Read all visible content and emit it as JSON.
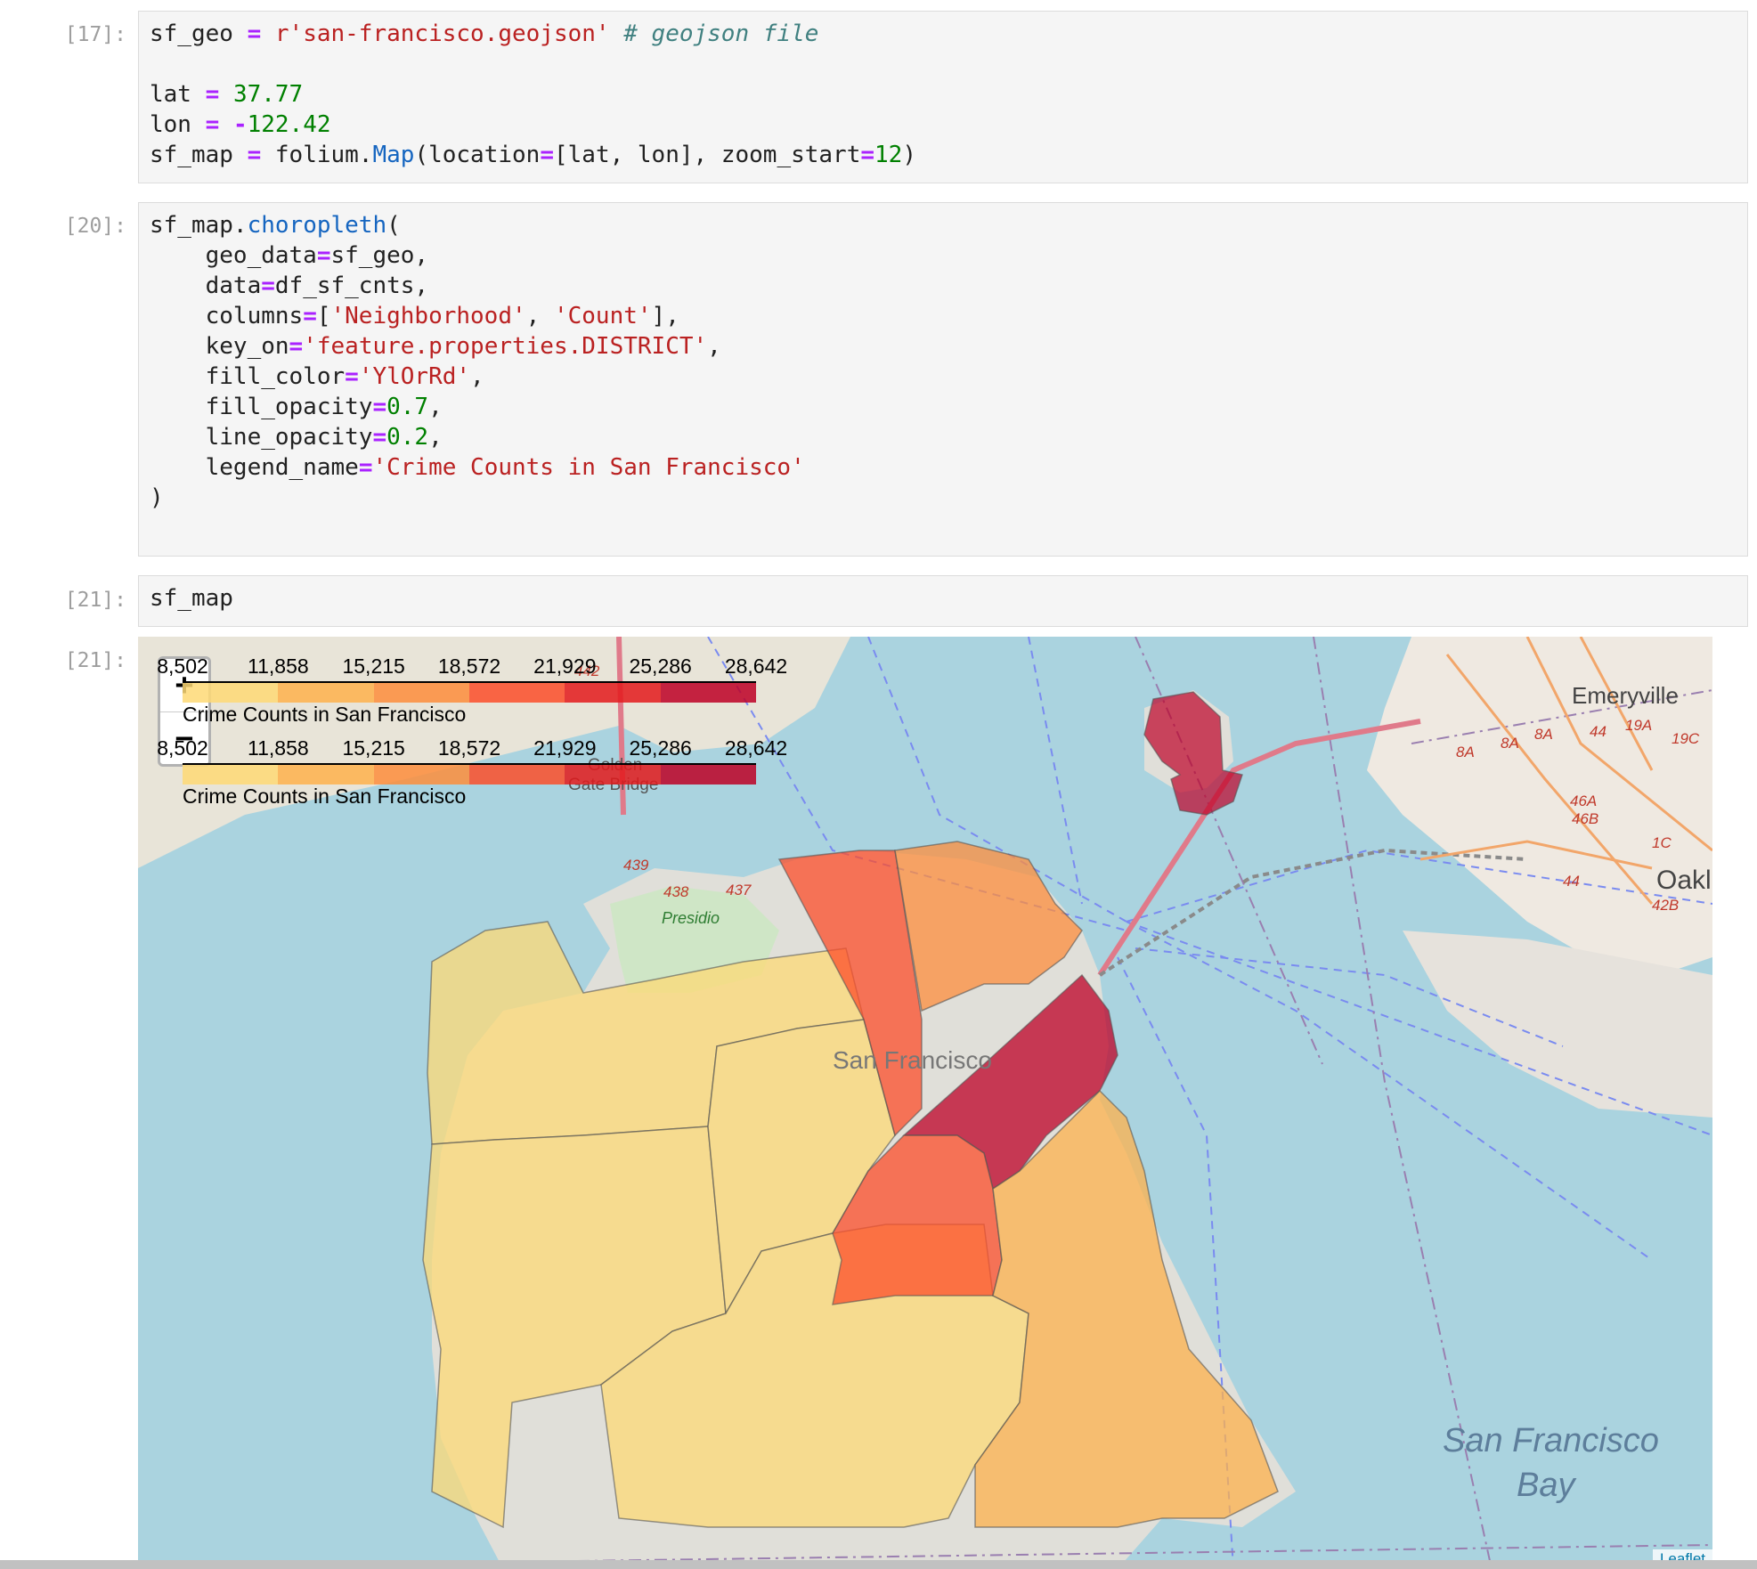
{
  "cells": [
    {
      "prompt": "[17]:",
      "lines": [
        [
          [
            "sf_geo ",
            ""
          ],
          [
            "=",
            "o"
          ],
          [
            " ",
            ""
          ],
          [
            "r'san-francisco.geojson'",
            "s"
          ],
          [
            " ",
            ""
          ],
          [
            "# geojson file",
            "c"
          ]
        ],
        [],
        [
          [
            "lat ",
            ""
          ],
          [
            "=",
            "o"
          ],
          [
            " ",
            ""
          ],
          [
            "37.77",
            "n"
          ]
        ],
        [
          [
            "lon ",
            ""
          ],
          [
            "=",
            "o"
          ],
          [
            " ",
            ""
          ],
          [
            "-",
            "o"
          ],
          [
            "122.42",
            "n"
          ]
        ],
        [
          [
            "sf_map ",
            ""
          ],
          [
            "=",
            "o"
          ],
          [
            " folium.",
            ""
          ],
          [
            "Map",
            "f"
          ],
          [
            "(location",
            ""
          ],
          [
            "=",
            "o"
          ],
          [
            "[lat, lon], zoom_start",
            ""
          ],
          [
            "=",
            "o"
          ],
          [
            "12",
            "n"
          ],
          [
            ")",
            ""
          ]
        ]
      ]
    },
    {
      "prompt": "[20]:",
      "lines": [
        [
          [
            "sf_map.",
            ""
          ],
          [
            "choropleth",
            "f"
          ],
          [
            "(",
            ""
          ]
        ],
        [
          [
            "    geo_data",
            ""
          ],
          [
            "=",
            "o"
          ],
          [
            "sf_geo,",
            ""
          ]
        ],
        [
          [
            "    data",
            ""
          ],
          [
            "=",
            "o"
          ],
          [
            "df_sf_cnts,",
            ""
          ]
        ],
        [
          [
            "    columns",
            ""
          ],
          [
            "=",
            "o"
          ],
          [
            "[",
            ""
          ],
          [
            "'Neighborhood'",
            "s"
          ],
          [
            ", ",
            ""
          ],
          [
            "'Count'",
            "s"
          ],
          [
            "],",
            ""
          ]
        ],
        [
          [
            "    key_on",
            ""
          ],
          [
            "=",
            "o"
          ],
          [
            "'feature.properties.DISTRICT'",
            "s"
          ],
          [
            ",",
            ""
          ]
        ],
        [
          [
            "    fill_color",
            ""
          ],
          [
            "=",
            "o"
          ],
          [
            "'YlOrRd'",
            "s"
          ],
          [
            ",",
            ""
          ]
        ],
        [
          [
            "    fill_opacity",
            ""
          ],
          [
            "=",
            "o"
          ],
          [
            "0.7",
            "n"
          ],
          [
            ",",
            ""
          ]
        ],
        [
          [
            "    line_opacity",
            ""
          ],
          [
            "=",
            "o"
          ],
          [
            "0.2",
            "n"
          ],
          [
            ",",
            ""
          ]
        ],
        [
          [
            "    legend_name",
            ""
          ],
          [
            "=",
            "o"
          ],
          [
            "'Crime Counts in San Francisco'",
            "s"
          ]
        ],
        [
          [
            ")",
            ""
          ]
        ]
      ]
    },
    {
      "prompt": "[21]:",
      "lines": [
        [
          [
            "sf_map",
            ""
          ]
        ]
      ]
    }
  ],
  "output": {
    "prompt": "[21]:",
    "zoom_in": "+",
    "zoom_out": "−",
    "legends": [
      {
        "ticks": [
          "8,502",
          "11,858",
          "15,215",
          "18,572",
          "21,929",
          "25,286",
          "28,642"
        ],
        "caption": "Crime Counts in San Francisco"
      },
      {
        "ticks": [
          "8,502",
          "11,858",
          "15,215",
          "18,572",
          "21,929",
          "25,286",
          "28,642"
        ],
        "caption": "Crime Counts in San Francisco"
      }
    ],
    "legend_colors": [
      "#fed976",
      "#feb24c",
      "#fd8d3c",
      "#fc4e2a",
      "#e31a1c",
      "#bd0026"
    ],
    "map_labels": {
      "city": "San Francisco",
      "bay_line1": "San Francisco",
      "bay_line2": "Bay",
      "emeryville": "Emeryville",
      "oakland": "Oakl",
      "presidio": "Presidio",
      "golden_gate_1": "Golden",
      "golden_gate_2": "Gate Bridge",
      "route_439": "439",
      "route_438": "438",
      "route_437": "437",
      "route_442": "442",
      "route_8a_1": "8A",
      "route_8a_2": "8A",
      "route_8a_3": "8A",
      "route_44_1": "44",
      "route_44_2": "44",
      "route_19a": "19A",
      "route_19c": "19C",
      "route_46a": "46A",
      "route_46b": "46B",
      "route_1c": "1C",
      "route_42b": "42B"
    },
    "attribution": "Leaflet"
  }
}
